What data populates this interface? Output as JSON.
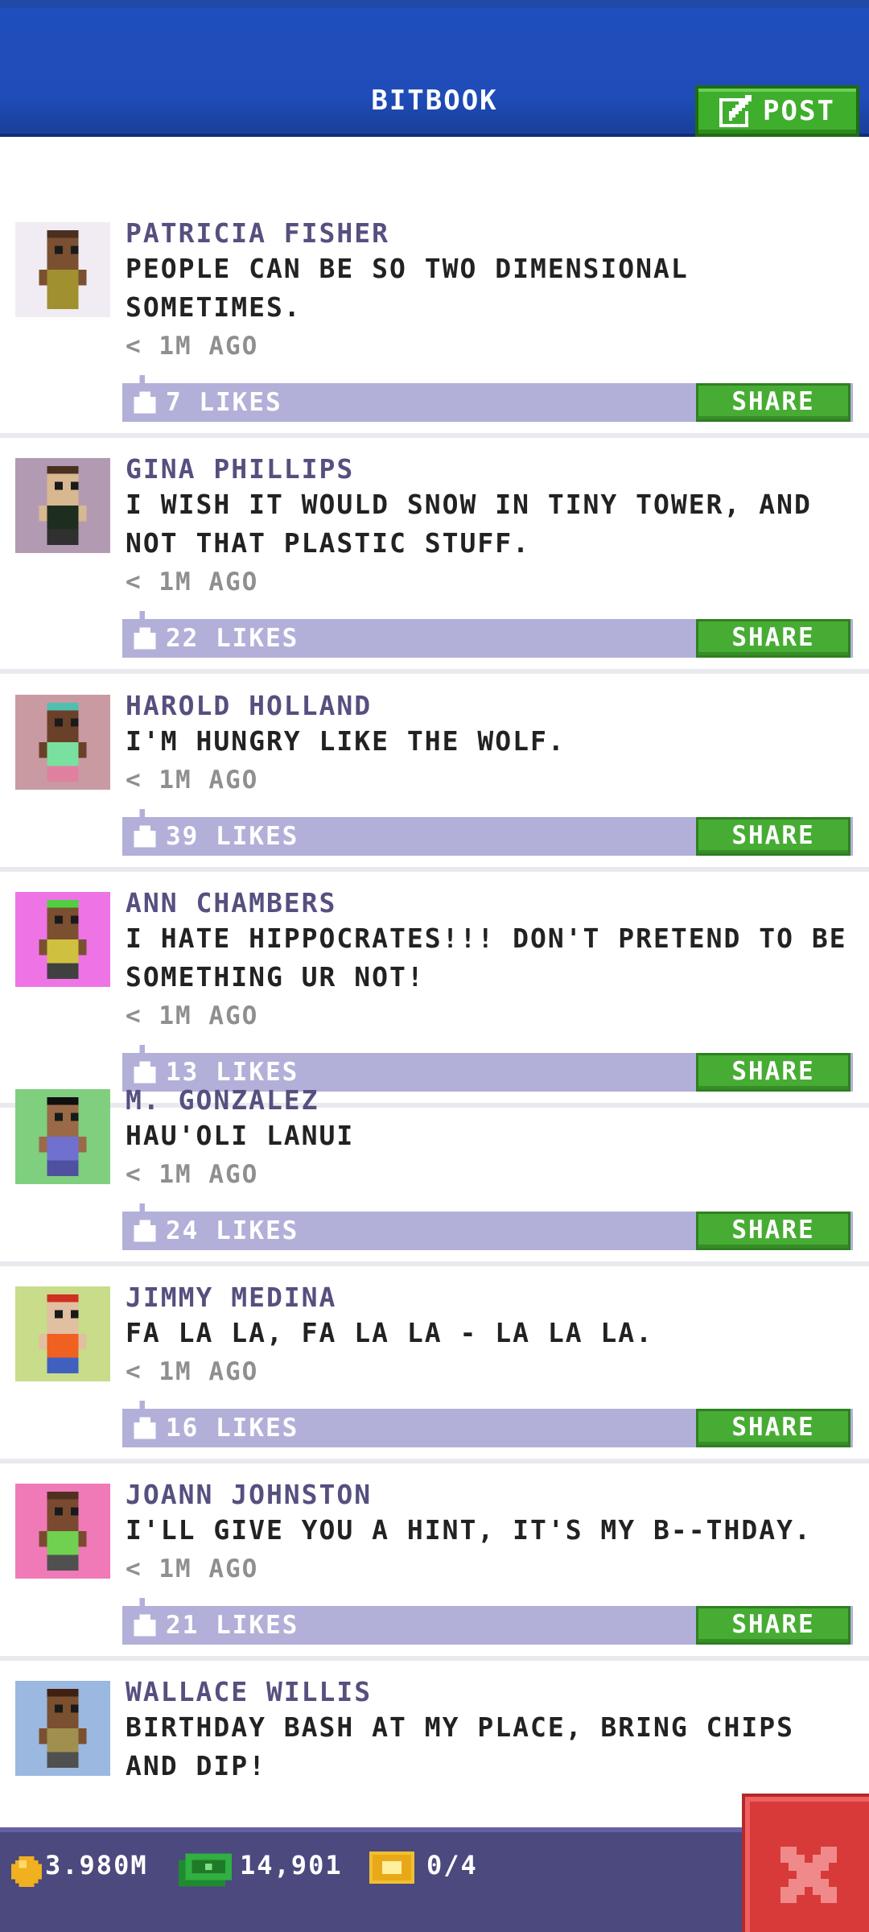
{
  "header": {
    "title": "BITBOOK",
    "post_label": "POST"
  },
  "colors": {
    "header_blue": "#1f4cb8",
    "author_purple": "#55507f",
    "likes_bar": "#b2b0d9",
    "share_green": "#47ac33",
    "bottom_bar": "#4b497e",
    "close_red": "#d83a3a"
  },
  "posts": [
    {
      "author": "PATRICIA FISHER",
      "lines": [
        "PEOPLE CAN BE SO TWO DIMENSIONAL",
        "SOMETIMES."
      ],
      "time": "< 1M AGO",
      "likes": "7 LIKES",
      "share": "SHARE",
      "avatar_bg": "#f1ecf3",
      "skin": "#7a5030",
      "hair": "#4a3020",
      "shirt": "#a09030",
      "pants": "#a09030"
    },
    {
      "author": "GINA PHILLIPS",
      "lines": [
        "I WISH IT WOULD SNOW IN TINY TOWER, AND",
        "NOT THAT PLASTIC STUFF."
      ],
      "time": "< 1M AGO",
      "likes": "22 LIKES",
      "share": "SHARE",
      "avatar_bg": "#b39ab3",
      "skin": "#d8b890",
      "hair": "#4a3020",
      "shirt": "#1e2e1e",
      "pants": "#303030"
    },
    {
      "author": "HAROLD HOLLAND",
      "lines": [
        "I'M HUNGRY LIKE THE WOLF."
      ],
      "time": "< 1M AGO",
      "likes": "39 LIKES",
      "share": "SHARE",
      "avatar_bg": "#c99aa2",
      "skin": "#6a4028",
      "hair": "#4fc0b0",
      "shirt": "#7ae0a0",
      "pants": "#e080a0"
    },
    {
      "author": "ANN CHAMBERS",
      "lines": [
        "I HATE HIPPOCRATES!!! DON'T PRETEND TO BE",
        "SOMETHING UR NOT!"
      ],
      "time": "< 1M AGO",
      "likes": "13 LIKES",
      "share": "SHARE",
      "avatar_bg": "#ee74e6",
      "skin": "#7a5030",
      "hair": "#50d040",
      "shirt": "#d0c040",
      "pants": "#404040"
    },
    {
      "author": "M. GONZALEZ",
      "lines": [
        "HAU'OLI LANUI"
      ],
      "time": "< 1M AGO",
      "likes": "24 LIKES",
      "share": "SHARE",
      "avatar_bg": "#7fcf7f",
      "skin": "#9a6a48",
      "hair": "#101010",
      "shirt": "#7070d0",
      "pants": "#5050a0"
    },
    {
      "author": "JIMMY MEDINA",
      "lines": [
        "FA LA LA, FA LA LA - LA LA LA."
      ],
      "time": "< 1M AGO",
      "likes": "16 LIKES",
      "share": "SHARE",
      "avatar_bg": "#c8dc8a",
      "skin": "#e0c0a0",
      "hair": "#d03020",
      "shirt": "#f06020",
      "pants": "#4060c0"
    },
    {
      "author": "JOANN JOHNSTON",
      "lines": [
        "I'LL GIVE YOU A HINT, IT'S MY B--THDAY."
      ],
      "time": "< 1M AGO",
      "likes": "21 LIKES",
      "share": "SHARE",
      "avatar_bg": "#f07ab8",
      "skin": "#7a4a30",
      "hair": "#503020",
      "shirt": "#70d050",
      "pants": "#505050"
    },
    {
      "author": "WALLACE WILLIS",
      "lines": [
        "BIRTHDAY BASH AT MY PLACE, BRING CHIPS",
        "AND DIP!"
      ],
      "time": "",
      "likes": "",
      "share": "",
      "avatar_bg": "#9ab8e0",
      "skin": "#7a5030",
      "hair": "#402010",
      "shirt": "#a09050",
      "pants": "#505050"
    }
  ],
  "status": {
    "coins": "3.980M",
    "bux": "14,901",
    "tickets": "0/4"
  }
}
